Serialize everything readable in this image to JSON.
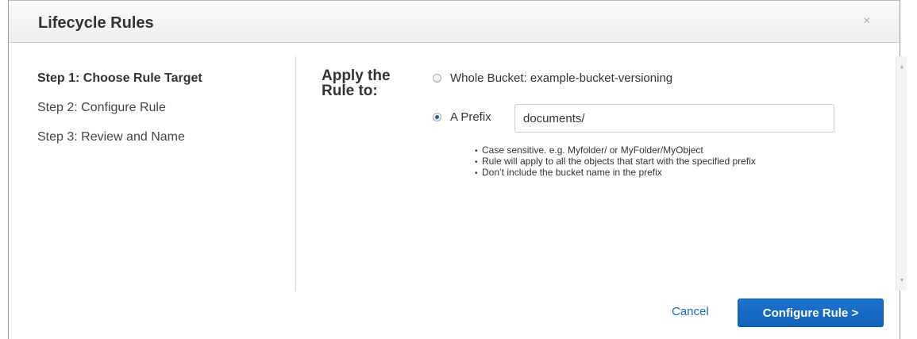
{
  "dialog": {
    "title": "Lifecycle Rules",
    "close_icon": "close-icon",
    "close_glyph": "×"
  },
  "steps": [
    {
      "label": "Step 1: Choose Rule Target",
      "active": true
    },
    {
      "label": "Step 2: Configure Rule",
      "active": false
    },
    {
      "label": "Step 3: Review and Name",
      "active": false
    }
  ],
  "target": {
    "heading_line1": "Apply the",
    "heading_line2": "Rule to:",
    "options": [
      {
        "label": "Whole Bucket: example-bucket-versioning",
        "selected": false
      },
      {
        "label": "A Prefix",
        "selected": true
      }
    ],
    "prefix_value": "documents/",
    "hints": [
      "Case sensitive. e.g. Myfolder/ or MyFolder/MyObject",
      "Rule will apply to all the objects that start with the specified prefix",
      "Don’t include the bucket name in the prefix"
    ]
  },
  "scrollbar": {
    "up_glyph": "▲",
    "down_glyph": "▼"
  },
  "footer": {
    "cancel_label": "Cancel",
    "primary_label": "Configure Rule >"
  },
  "colors": {
    "primary_button": "#1668c2",
    "link": "#1a6bb8",
    "radio_dot": "#2a5aa8"
  }
}
